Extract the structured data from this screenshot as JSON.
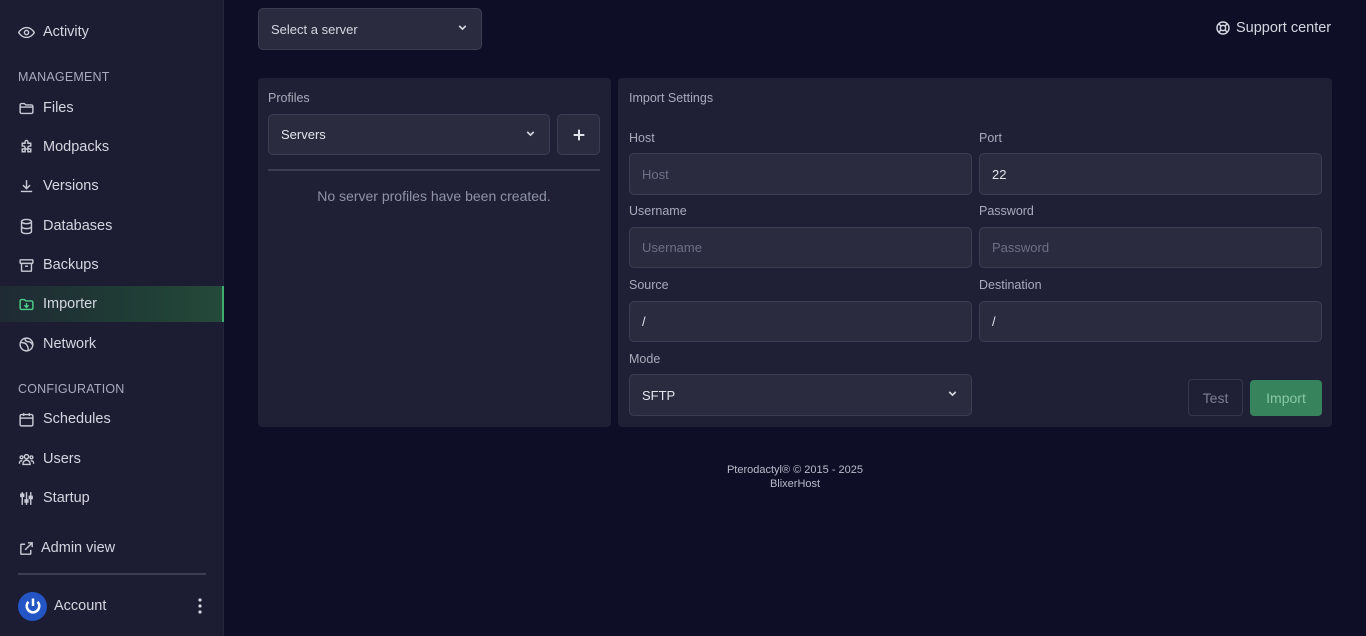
{
  "sidebar": {
    "items_top": [
      {
        "label": "Activity",
        "icon": "eye-icon"
      }
    ],
    "management_label": "MANAGEMENT",
    "management_items": [
      {
        "label": "Files",
        "icon": "folder-icon"
      },
      {
        "label": "Modpacks",
        "icon": "puzzle-icon"
      },
      {
        "label": "Versions",
        "icon": "download-icon"
      },
      {
        "label": "Databases",
        "icon": "database-icon"
      },
      {
        "label": "Backups",
        "icon": "archive-icon"
      },
      {
        "label": "Importer",
        "icon": "folder-import-icon",
        "active": true
      },
      {
        "label": "Network",
        "icon": "globe-icon"
      }
    ],
    "configuration_label": "CONFIGURATION",
    "configuration_items": [
      {
        "label": "Schedules",
        "icon": "calendar-icon"
      },
      {
        "label": "Users",
        "icon": "users-icon"
      },
      {
        "label": "Startup",
        "icon": "sliders-icon"
      }
    ],
    "admin_view_label": "Admin view",
    "account_label": "Account",
    "active_color": "#3fae6f"
  },
  "header": {
    "server_select_placeholder": "Select a server",
    "support_label": "Support center"
  },
  "profiles": {
    "title": "Profiles",
    "selected": "Servers",
    "empty_message": "No server profiles have been created."
  },
  "import_settings": {
    "title": "Import Settings",
    "host": {
      "label": "Host",
      "placeholder": "Host",
      "value": ""
    },
    "port": {
      "label": "Port",
      "placeholder": "",
      "value": "22"
    },
    "username": {
      "label": "Username",
      "placeholder": "Username",
      "value": ""
    },
    "password": {
      "label": "Password",
      "placeholder": "Password",
      "value": ""
    },
    "source": {
      "label": "Source",
      "value": "/"
    },
    "destination": {
      "label": "Destination",
      "value": "/"
    },
    "mode": {
      "label": "Mode",
      "selected": "SFTP"
    },
    "test_label": "Test",
    "import_label": "Import",
    "import_color": "#36835c"
  },
  "footer": {
    "line1": "Pterodactyl® © 2015 - 2025",
    "line2": "BlixerHost"
  }
}
